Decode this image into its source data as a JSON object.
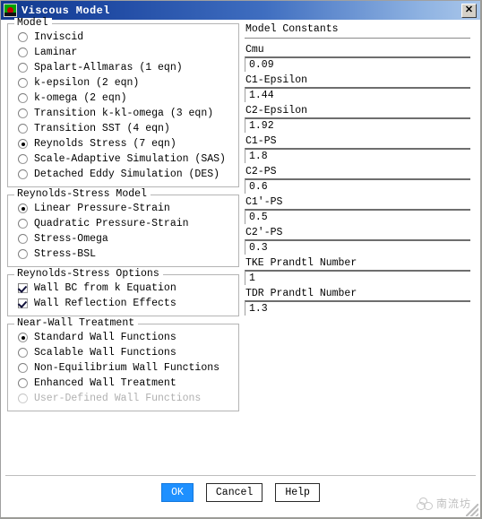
{
  "window": {
    "title": "Viscous Model",
    "icon": "fluent-app-icon",
    "close_label": "✕"
  },
  "model_group": {
    "title": "Model",
    "selected": "Reynolds Stress (7 eqn)",
    "options": [
      {
        "label": "Inviscid",
        "selected": false,
        "disabled": false
      },
      {
        "label": "Laminar",
        "selected": false,
        "disabled": false
      },
      {
        "label": "Spalart-Allmaras (1 eqn)",
        "selected": false,
        "disabled": false
      },
      {
        "label": "k-epsilon (2 eqn)",
        "selected": false,
        "disabled": false
      },
      {
        "label": "k-omega (2 eqn)",
        "selected": false,
        "disabled": false
      },
      {
        "label": "Transition k-kl-omega (3 eqn)",
        "selected": false,
        "disabled": false
      },
      {
        "label": "Transition SST (4 eqn)",
        "selected": false,
        "disabled": false
      },
      {
        "label": "Reynolds Stress (7 eqn)",
        "selected": true,
        "disabled": false
      },
      {
        "label": "Scale-Adaptive Simulation (SAS)",
        "selected": false,
        "disabled": false
      },
      {
        "label": "Detached Eddy Simulation (DES)",
        "selected": false,
        "disabled": false
      }
    ]
  },
  "rsm_group": {
    "title": "Reynolds-Stress Model",
    "selected": "Linear Pressure-Strain",
    "options": [
      {
        "label": "Linear Pressure-Strain",
        "selected": true,
        "disabled": false
      },
      {
        "label": "Quadratic Pressure-Strain",
        "selected": false,
        "disabled": false
      },
      {
        "label": "Stress-Omega",
        "selected": false,
        "disabled": false
      },
      {
        "label": "Stress-BSL",
        "selected": false,
        "disabled": false
      }
    ]
  },
  "rs_options_group": {
    "title": "Reynolds-Stress Options",
    "options": [
      {
        "label": "Wall BC from k Equation",
        "checked": true
      },
      {
        "label": "Wall Reflection Effects",
        "checked": true
      }
    ]
  },
  "near_wall_group": {
    "title": "Near-Wall Treatment",
    "selected": "Standard Wall Functions",
    "options": [
      {
        "label": "Standard Wall Functions",
        "selected": true,
        "disabled": false
      },
      {
        "label": "Scalable Wall Functions",
        "selected": false,
        "disabled": false
      },
      {
        "label": "Non-Equilibrium Wall Functions",
        "selected": false,
        "disabled": false
      },
      {
        "label": "Enhanced Wall Treatment",
        "selected": false,
        "disabled": false
      },
      {
        "label": "User-Defined Wall Functions",
        "selected": false,
        "disabled": true
      }
    ]
  },
  "model_constants": {
    "title": "Model Constants",
    "fields": [
      {
        "label": "Cmu",
        "value": "0.09"
      },
      {
        "label": "C1-Epsilon",
        "value": "1.44"
      },
      {
        "label": "C2-Epsilon",
        "value": "1.92"
      },
      {
        "label": "C1-PS",
        "value": "1.8"
      },
      {
        "label": "C2-PS",
        "value": "0.6"
      },
      {
        "label": "C1'-PS",
        "value": "0.5"
      },
      {
        "label": "C2'-PS",
        "value": "0.3"
      },
      {
        "label": "TKE Prandtl Number",
        "value": "1"
      },
      {
        "label": "TDR Prandtl Number",
        "value": "1.3"
      }
    ]
  },
  "footer": {
    "ok_label": "OK",
    "cancel_label": "Cancel",
    "help_label": "Help"
  },
  "watermark": {
    "text": "南流坊"
  },
  "colors": {
    "title_bar_start": "#133a8e",
    "title_bar_end": "#a9c6ea",
    "primary_button": "#1e90ff",
    "checkmark": "#12123c",
    "group_border": "#b4b4b4"
  }
}
